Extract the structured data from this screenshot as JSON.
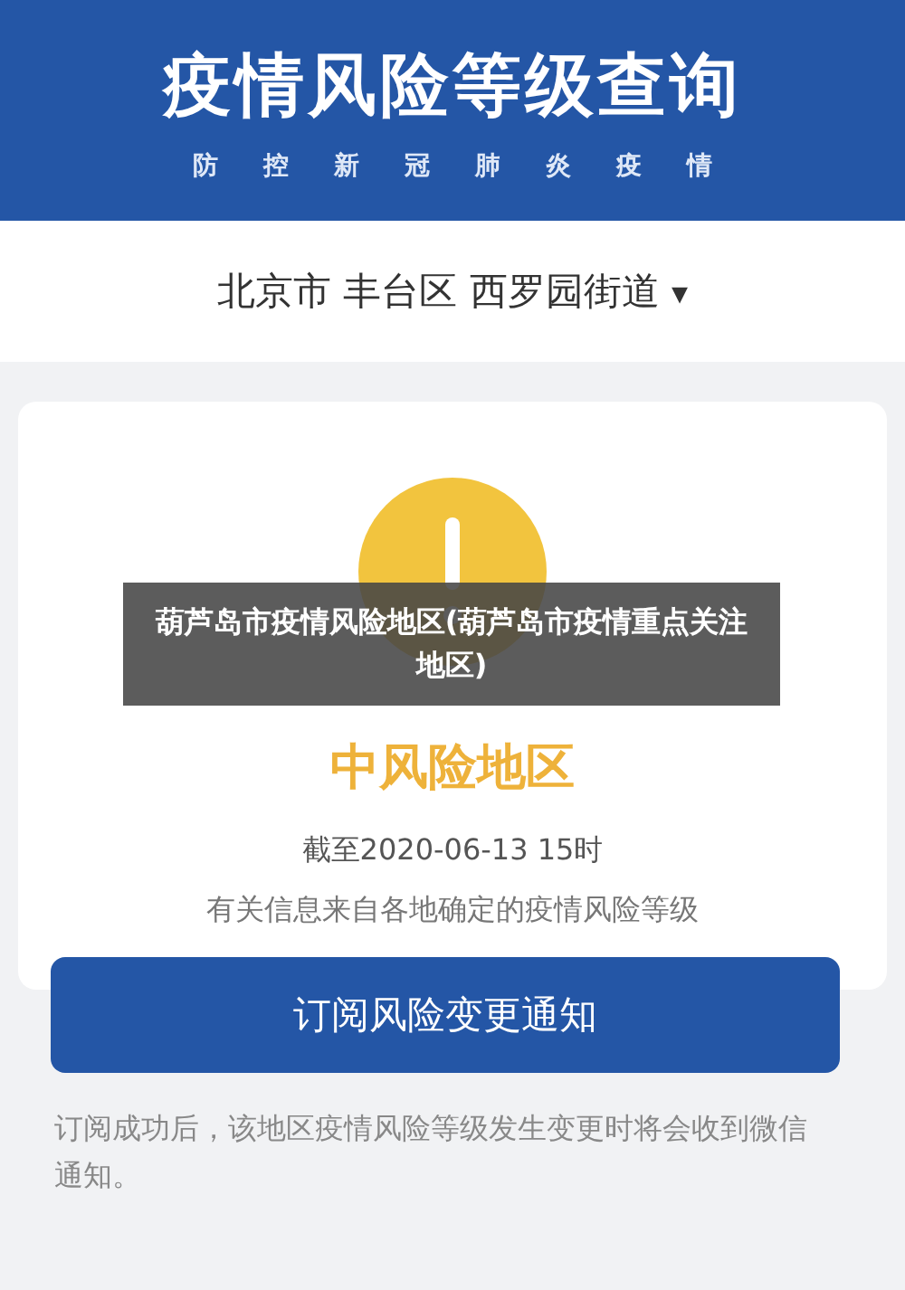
{
  "header": {
    "title": "疫情风险等级查询",
    "subtitle": [
      "防",
      "控",
      "新",
      "冠",
      "肺",
      "炎",
      "疫",
      "情"
    ]
  },
  "location": {
    "parts": [
      "北京市",
      "丰台区",
      "西罗园街道"
    ],
    "caret": "▾"
  },
  "result": {
    "kind": "medium",
    "label": "中风险地区",
    "time": "截至2020-06-13 15时",
    "source": "有关信息来自各地确定的疫情风险等级"
  },
  "subscribe_button": "订阅风险变更通知",
  "note": "订阅成功后，该地区疫情风险等级发生变更时将会收到微信通知。",
  "overlay_caption": "葫芦岛市疫情风险地区(葫芦岛市疫情重点关注地区)"
}
